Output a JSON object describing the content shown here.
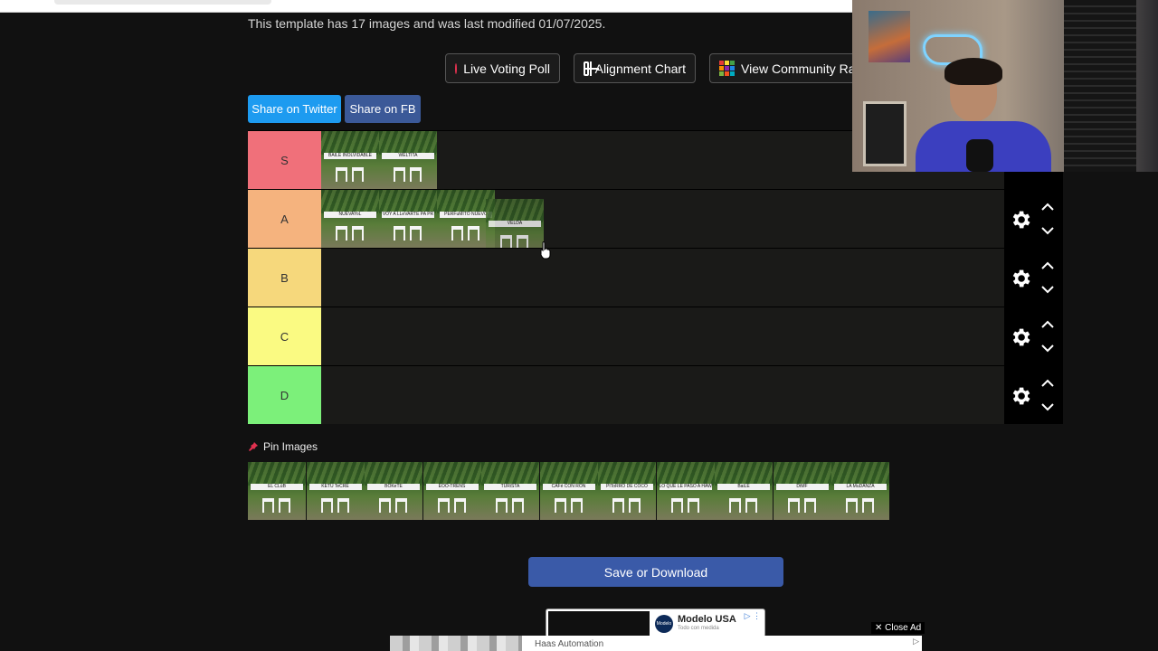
{
  "template_info": "This template has 17 images and was last modified 01/07/2025.",
  "toolbar": {
    "live_voting_poll": "Live Voting Poll",
    "alignment_chart": "Alignment Chart",
    "view_community_rankings": "View Community Ran"
  },
  "share": {
    "twitter": "Share on Twitter",
    "facebook": "Share on FB"
  },
  "colors": {
    "tier_s": "#f0707a",
    "tier_a": "#f5b37e",
    "tier_b": "#f6d87c",
    "tier_c": "#fafa82",
    "tier_d": "#7cf07a",
    "twitter": "#1d9bf0",
    "facebook": "#3b5998"
  },
  "tiers": [
    {
      "label": "S",
      "items": [
        "BAILE INOLVIDABLE",
        "WELTITA"
      ]
    },
    {
      "label": "A",
      "items": [
        "NUEVAYoL",
        "VOY A LLeVARTE PA PR",
        "PERFuMITO NUEVO",
        "VELDÁ"
      ]
    },
    {
      "label": "B",
      "items": []
    },
    {
      "label": "C",
      "items": []
    },
    {
      "label": "D",
      "items": []
    }
  ],
  "pin_images_label": "Pin Images",
  "pool_items": [
    "EL CLúB",
    "KETU TeCRÉ",
    "BOKeTE",
    "EOO-TRENS",
    "TURiSTA",
    "CAFé CON RON",
    "PIToRRO DE COCO",
    "LO QUE LE PASÓ A HAWAii",
    "BaiLE",
    "DtMF",
    "LA MuDANZA"
  ],
  "save_button": "Save or Download",
  "ad": {
    "brand": "Modelo USA",
    "brand_sub": "Todo con medida",
    "logo_text": "Modelo",
    "close": "Close Ad",
    "banner_text": "Haas Automation"
  }
}
